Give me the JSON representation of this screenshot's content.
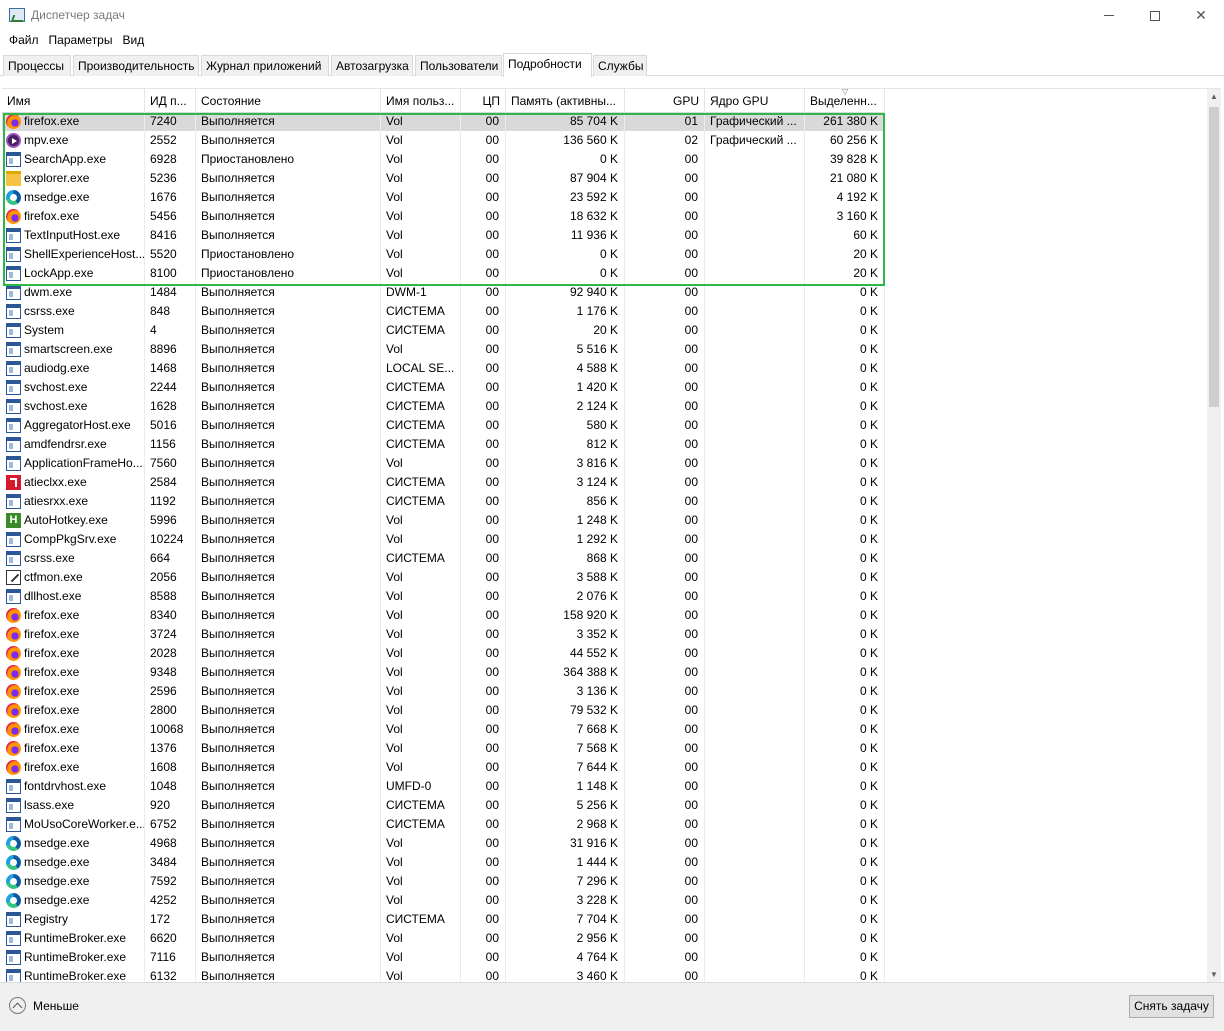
{
  "window": {
    "title": "Диспетчер задач",
    "min_icon": "minimize-icon",
    "max_icon": "maximize-icon",
    "close_label": "✕"
  },
  "menu": [
    "Файл",
    "Параметры",
    "Вид"
  ],
  "tabs": [
    "Процессы",
    "Производительность",
    "Журнал приложений",
    "Автозагрузка",
    "Пользователи",
    "Подробности",
    "Службы"
  ],
  "active_tab": "Подробности",
  "columns": [
    "Имя",
    "ИД п...",
    "Состояние",
    "Имя польз...",
    "ЦП",
    "Память (активны...",
    "GPU",
    "Ядро GPU",
    "Выделенн..."
  ],
  "rows": [
    {
      "icon": "firefox",
      "name": "firefox.exe",
      "pid": "7240",
      "state": "Выполняется",
      "user": "Vol",
      "cpu": "00",
      "mem": "85 704 K",
      "gpu": "01",
      "engine": "Графический ...",
      "ded": "261 380 K"
    },
    {
      "icon": "mpv",
      "name": "mpv.exe",
      "pid": "2552",
      "state": "Выполняется",
      "user": "Vol",
      "cpu": "00",
      "mem": "136 560 K",
      "gpu": "02",
      "engine": "Графический ...",
      "ded": "60 256 K"
    },
    {
      "icon": "generic",
      "name": "SearchApp.exe",
      "pid": "6928",
      "state": "Приостановлено",
      "user": "Vol",
      "cpu": "00",
      "mem": "0 K",
      "gpu": "00",
      "engine": "",
      "ded": "39 828 K"
    },
    {
      "icon": "folder",
      "name": "explorer.exe",
      "pid": "5236",
      "state": "Выполняется",
      "user": "Vol",
      "cpu": "00",
      "mem": "87 904 K",
      "gpu": "00",
      "engine": "",
      "ded": "21 080 K"
    },
    {
      "icon": "edge",
      "name": "msedge.exe",
      "pid": "1676",
      "state": "Выполняется",
      "user": "Vol",
      "cpu": "00",
      "mem": "23 592 K",
      "gpu": "00",
      "engine": "",
      "ded": "4 192 K"
    },
    {
      "icon": "firefox",
      "name": "firefox.exe",
      "pid": "5456",
      "state": "Выполняется",
      "user": "Vol",
      "cpu": "00",
      "mem": "18 632 K",
      "gpu": "00",
      "engine": "",
      "ded": "3 160 K"
    },
    {
      "icon": "generic",
      "name": "TextInputHost.exe",
      "pid": "8416",
      "state": "Выполняется",
      "user": "Vol",
      "cpu": "00",
      "mem": "11 936 K",
      "gpu": "00",
      "engine": "",
      "ded": "60 K"
    },
    {
      "icon": "generic",
      "name": "ShellExperienceHost....",
      "pid": "5520",
      "state": "Приостановлено",
      "user": "Vol",
      "cpu": "00",
      "mem": "0 K",
      "gpu": "00",
      "engine": "",
      "ded": "20 K"
    },
    {
      "icon": "generic",
      "name": "LockApp.exe",
      "pid": "8100",
      "state": "Приостановлено",
      "user": "Vol",
      "cpu": "00",
      "mem": "0 K",
      "gpu": "00",
      "engine": "",
      "ded": "20 K"
    },
    {
      "icon": "generic",
      "name": "dwm.exe",
      "pid": "1484",
      "state": "Выполняется",
      "user": "DWM-1",
      "cpu": "00",
      "mem": "92 940 K",
      "gpu": "00",
      "engine": "",
      "ded": "0 K"
    },
    {
      "icon": "generic",
      "name": "csrss.exe",
      "pid": "848",
      "state": "Выполняется",
      "user": "СИСТЕМА",
      "cpu": "00",
      "mem": "1 176 K",
      "gpu": "00",
      "engine": "",
      "ded": "0 K"
    },
    {
      "icon": "generic",
      "name": "System",
      "pid": "4",
      "state": "Выполняется",
      "user": "СИСТЕМА",
      "cpu": "00",
      "mem": "20 K",
      "gpu": "00",
      "engine": "",
      "ded": "0 K"
    },
    {
      "icon": "generic",
      "name": "smartscreen.exe",
      "pid": "8896",
      "state": "Выполняется",
      "user": "Vol",
      "cpu": "00",
      "mem": "5 516 K",
      "gpu": "00",
      "engine": "",
      "ded": "0 K"
    },
    {
      "icon": "generic",
      "name": "audiodg.exe",
      "pid": "1468",
      "state": "Выполняется",
      "user": "LOCAL SE...",
      "cpu": "00",
      "mem": "4 588 K",
      "gpu": "00",
      "engine": "",
      "ded": "0 K"
    },
    {
      "icon": "generic",
      "name": "svchost.exe",
      "pid": "2244",
      "state": "Выполняется",
      "user": "СИСТЕМА",
      "cpu": "00",
      "mem": "1 420 K",
      "gpu": "00",
      "engine": "",
      "ded": "0 K"
    },
    {
      "icon": "generic",
      "name": "svchost.exe",
      "pid": "1628",
      "state": "Выполняется",
      "user": "СИСТЕМА",
      "cpu": "00",
      "mem": "2 124 K",
      "gpu": "00",
      "engine": "",
      "ded": "0 K"
    },
    {
      "icon": "generic",
      "name": "AggregatorHost.exe",
      "pid": "5016",
      "state": "Выполняется",
      "user": "СИСТЕМА",
      "cpu": "00",
      "mem": "580 K",
      "gpu": "00",
      "engine": "",
      "ded": "0 K"
    },
    {
      "icon": "generic",
      "name": "amdfendrsr.exe",
      "pid": "1156",
      "state": "Выполняется",
      "user": "СИСТЕМА",
      "cpu": "00",
      "mem": "812 K",
      "gpu": "00",
      "engine": "",
      "ded": "0 K"
    },
    {
      "icon": "generic",
      "name": "ApplicationFrameHo...",
      "pid": "7560",
      "state": "Выполняется",
      "user": "Vol",
      "cpu": "00",
      "mem": "3 816 K",
      "gpu": "00",
      "engine": "",
      "ded": "0 K"
    },
    {
      "icon": "amd",
      "name": "atieclxx.exe",
      "pid": "2584",
      "state": "Выполняется",
      "user": "СИСТЕМА",
      "cpu": "00",
      "mem": "3 124 K",
      "gpu": "00",
      "engine": "",
      "ded": "0 K"
    },
    {
      "icon": "generic",
      "name": "atiesrxx.exe",
      "pid": "1192",
      "state": "Выполняется",
      "user": "СИСТЕМА",
      "cpu": "00",
      "mem": "856 K",
      "gpu": "00",
      "engine": "",
      "ded": "0 K"
    },
    {
      "icon": "ahk",
      "name": "AutoHotkey.exe",
      "pid": "5996",
      "state": "Выполняется",
      "user": "Vol",
      "cpu": "00",
      "mem": "1 248 K",
      "gpu": "00",
      "engine": "",
      "ded": "0 K"
    },
    {
      "icon": "generic",
      "name": "CompPkgSrv.exe",
      "pid": "10224",
      "state": "Выполняется",
      "user": "Vol",
      "cpu": "00",
      "mem": "1 292 K",
      "gpu": "00",
      "engine": "",
      "ded": "0 K"
    },
    {
      "icon": "generic",
      "name": "csrss.exe",
      "pid": "664",
      "state": "Выполняется",
      "user": "СИСТЕМА",
      "cpu": "00",
      "mem": "868 K",
      "gpu": "00",
      "engine": "",
      "ded": "0 K"
    },
    {
      "icon": "ctf",
      "name": "ctfmon.exe",
      "pid": "2056",
      "state": "Выполняется",
      "user": "Vol",
      "cpu": "00",
      "mem": "3 588 K",
      "gpu": "00",
      "engine": "",
      "ded": "0 K"
    },
    {
      "icon": "generic",
      "name": "dllhost.exe",
      "pid": "8588",
      "state": "Выполняется",
      "user": "Vol",
      "cpu": "00",
      "mem": "2 076 K",
      "gpu": "00",
      "engine": "",
      "ded": "0 K"
    },
    {
      "icon": "firefox",
      "name": "firefox.exe",
      "pid": "8340",
      "state": "Выполняется",
      "user": "Vol",
      "cpu": "00",
      "mem": "158 920 K",
      "gpu": "00",
      "engine": "",
      "ded": "0 K"
    },
    {
      "icon": "firefox",
      "name": "firefox.exe",
      "pid": "3724",
      "state": "Выполняется",
      "user": "Vol",
      "cpu": "00",
      "mem": "3 352 K",
      "gpu": "00",
      "engine": "",
      "ded": "0 K"
    },
    {
      "icon": "firefox",
      "name": "firefox.exe",
      "pid": "2028",
      "state": "Выполняется",
      "user": "Vol",
      "cpu": "00",
      "mem": "44 552 K",
      "gpu": "00",
      "engine": "",
      "ded": "0 K"
    },
    {
      "icon": "firefox",
      "name": "firefox.exe",
      "pid": "9348",
      "state": "Выполняется",
      "user": "Vol",
      "cpu": "00",
      "mem": "364 388 K",
      "gpu": "00",
      "engine": "",
      "ded": "0 K"
    },
    {
      "icon": "firefox",
      "name": "firefox.exe",
      "pid": "2596",
      "state": "Выполняется",
      "user": "Vol",
      "cpu": "00",
      "mem": "3 136 K",
      "gpu": "00",
      "engine": "",
      "ded": "0 K"
    },
    {
      "icon": "firefox",
      "name": "firefox.exe",
      "pid": "2800",
      "state": "Выполняется",
      "user": "Vol",
      "cpu": "00",
      "mem": "79 532 K",
      "gpu": "00",
      "engine": "",
      "ded": "0 K"
    },
    {
      "icon": "firefox",
      "name": "firefox.exe",
      "pid": "10068",
      "state": "Выполняется",
      "user": "Vol",
      "cpu": "00",
      "mem": "7 668 K",
      "gpu": "00",
      "engine": "",
      "ded": "0 K"
    },
    {
      "icon": "firefox",
      "name": "firefox.exe",
      "pid": "1376",
      "state": "Выполняется",
      "user": "Vol",
      "cpu": "00",
      "mem": "7 568 K",
      "gpu": "00",
      "engine": "",
      "ded": "0 K"
    },
    {
      "icon": "firefox",
      "name": "firefox.exe",
      "pid": "1608",
      "state": "Выполняется",
      "user": "Vol",
      "cpu": "00",
      "mem": "7 644 K",
      "gpu": "00",
      "engine": "",
      "ded": "0 K"
    },
    {
      "icon": "generic",
      "name": "fontdrvhost.exe",
      "pid": "1048",
      "state": "Выполняется",
      "user": "UMFD-0",
      "cpu": "00",
      "mem": "1 148 K",
      "gpu": "00",
      "engine": "",
      "ded": "0 K"
    },
    {
      "icon": "generic",
      "name": "lsass.exe",
      "pid": "920",
      "state": "Выполняется",
      "user": "СИСТЕМА",
      "cpu": "00",
      "mem": "5 256 K",
      "gpu": "00",
      "engine": "",
      "ded": "0 K"
    },
    {
      "icon": "generic",
      "name": "MoUsoCoreWorker.e...",
      "pid": "6752",
      "state": "Выполняется",
      "user": "СИСТЕМА",
      "cpu": "00",
      "mem": "2 968 K",
      "gpu": "00",
      "engine": "",
      "ded": "0 K"
    },
    {
      "icon": "edge",
      "name": "msedge.exe",
      "pid": "4968",
      "state": "Выполняется",
      "user": "Vol",
      "cpu": "00",
      "mem": "31 916 K",
      "gpu": "00",
      "engine": "",
      "ded": "0 K"
    },
    {
      "icon": "edge",
      "name": "msedge.exe",
      "pid": "3484",
      "state": "Выполняется",
      "user": "Vol",
      "cpu": "00",
      "mem": "1 444 K",
      "gpu": "00",
      "engine": "",
      "ded": "0 K"
    },
    {
      "icon": "edge",
      "name": "msedge.exe",
      "pid": "7592",
      "state": "Выполняется",
      "user": "Vol",
      "cpu": "00",
      "mem": "7 296 K",
      "gpu": "00",
      "engine": "",
      "ded": "0 K"
    },
    {
      "icon": "edge",
      "name": "msedge.exe",
      "pid": "4252",
      "state": "Выполняется",
      "user": "Vol",
      "cpu": "00",
      "mem": "3 228 K",
      "gpu": "00",
      "engine": "",
      "ded": "0 K"
    },
    {
      "icon": "generic",
      "name": "Registry",
      "pid": "172",
      "state": "Выполняется",
      "user": "СИСТЕМА",
      "cpu": "00",
      "mem": "7 704 K",
      "gpu": "00",
      "engine": "",
      "ded": "0 K"
    },
    {
      "icon": "generic",
      "name": "RuntimeBroker.exe",
      "pid": "6620",
      "state": "Выполняется",
      "user": "Vol",
      "cpu": "00",
      "mem": "2 956 K",
      "gpu": "00",
      "engine": "",
      "ded": "0 K"
    },
    {
      "icon": "generic",
      "name": "RuntimeBroker.exe",
      "pid": "7116",
      "state": "Выполняется",
      "user": "Vol",
      "cpu": "00",
      "mem": "4 764 K",
      "gpu": "00",
      "engine": "",
      "ded": "0 K"
    },
    {
      "icon": "generic",
      "name": "RuntimeBroker.exe",
      "pid": "6132",
      "state": "Выполняется",
      "user": "Vol",
      "cpu": "00",
      "mem": "3 460 K",
      "gpu": "00",
      "engine": "",
      "ded": "0 K"
    }
  ],
  "footer": {
    "less_label": "Меньше",
    "end_task_label": "Снять задачу"
  },
  "colors": {
    "highlight_border": "#2fb84a",
    "selected_row": "#d9d9d9"
  }
}
